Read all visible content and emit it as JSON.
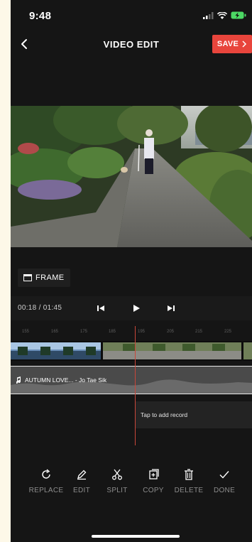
{
  "status_bar": {
    "time": "9:48"
  },
  "nav": {
    "title": "VIDEO EDIT",
    "save_label": "SAVE"
  },
  "frame_button": {
    "label": "FRAME"
  },
  "playback": {
    "current": "00:18",
    "total": "01:45",
    "timecode": "00:18 / 01:45"
  },
  "ruler_ticks": [
    "155",
    "165",
    "175",
    "185",
    "195",
    "205",
    "215",
    "225"
  ],
  "audio_track": {
    "label": "AUTUMN LOVE... - Jo Tae Sik"
  },
  "record_hint": "Tap to add record",
  "toolbar": {
    "items": [
      {
        "label": "REPLACE",
        "icon": "replace-icon"
      },
      {
        "label": "EDIT",
        "icon": "pencil-icon"
      },
      {
        "label": "SPLIT",
        "icon": "scissors-icon"
      },
      {
        "label": "COPY",
        "icon": "copy-icon"
      },
      {
        "label": "DELETE",
        "icon": "trash-icon"
      },
      {
        "label": "DONE",
        "icon": "check-icon"
      }
    ]
  },
  "colors": {
    "accent": "#e8453c",
    "background": "#151515",
    "playhead": "#c9473a"
  }
}
